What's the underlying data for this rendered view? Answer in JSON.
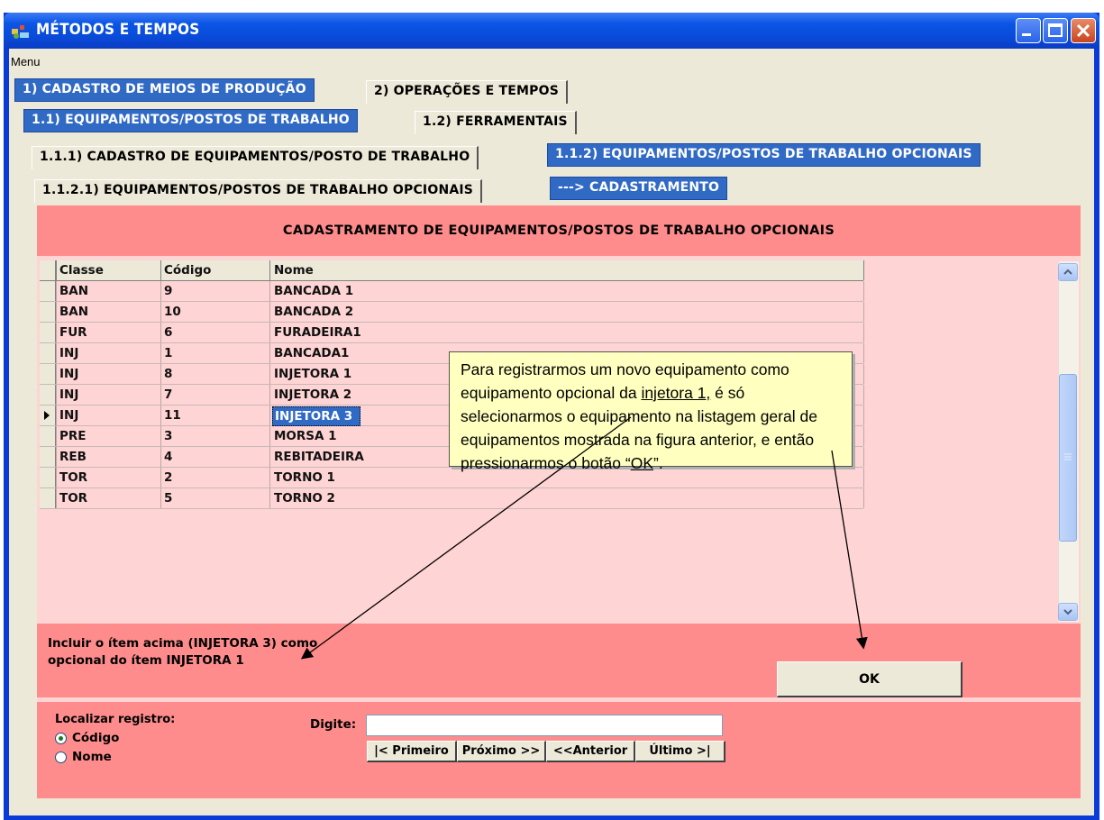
{
  "window": {
    "title": "MÉTODOS E TEMPOS",
    "menu_label": "Menu"
  },
  "tabs_level1": [
    {
      "label": "1) CADASTRO DE MEIOS DE PRODUÇÃO",
      "active": true
    },
    {
      "label": "2) OPERAÇÕES E TEMPOS",
      "active": false
    }
  ],
  "tabs_level2": [
    {
      "label": "1.1) EQUIPAMENTOS/POSTOS DE TRABALHO",
      "active": true
    },
    {
      "label": "1.2) FERRAMENTAIS",
      "active": false
    }
  ],
  "tabs_level3": [
    {
      "label": "1.1.1) CADASTRO DE EQUIPAMENTOS/POSTO DE TRABALHO",
      "active": false
    },
    {
      "label": "1.1.2) EQUIPAMENTOS/POSTOS DE TRABALHO OPCIONAIS",
      "active": true
    }
  ],
  "tabs_level4": [
    {
      "label": "1.1.2.1) EQUIPAMENTOS/POSTOS DE TRABALHO OPCIONAIS",
      "active": false
    },
    {
      "label": "---> CADASTRAMENTO",
      "active": true
    }
  ],
  "panel": {
    "header": "CADASTRAMENTO DE EQUIPAMENTOS/POSTOS DE TRABALHO OPCIONAIS"
  },
  "grid": {
    "columns": [
      "Classe",
      "Código",
      "Nome"
    ],
    "rows": [
      [
        "BAN",
        "9",
        "BANCADA 1"
      ],
      [
        "BAN",
        "10",
        "BANCADA 2"
      ],
      [
        "FUR",
        "6",
        "FURADEIRA1"
      ],
      [
        "INJ",
        "1",
        "BANCADA1"
      ],
      [
        "INJ",
        "8",
        "INJETORA 1"
      ],
      [
        "INJ",
        "7",
        "INJETORA 2"
      ],
      [
        "INJ",
        "11",
        "INJETORA 3"
      ],
      [
        "PRE",
        "3",
        "MORSA 1"
      ],
      [
        "REB",
        "4",
        "REBITADEIRA"
      ],
      [
        "TOR",
        "2",
        "TORNO 1"
      ],
      [
        "TOR",
        "5",
        "TORNO 2"
      ]
    ],
    "selected_row": 6
  },
  "include": {
    "line1": "Incluir o ítem acima (INJETORA 3) como",
    "line2": "opcional do ítem INJETORA 1",
    "ok_label": "OK"
  },
  "locate": {
    "title": "Localizar registro:",
    "option_code": "Código",
    "option_name": "Nome",
    "selected_option": "Código",
    "digite_label": "Digite:",
    "search_value": "",
    "nav_first": "|< Primeiro",
    "nav_next": "Próximo >>",
    "nav_prev": "<<Anterior",
    "nav_last": "Último >|"
  },
  "callout": {
    "part1": "Para registrarmos um novo equipamento como equipamento opcional da ",
    "underlined1": "injetora 1,",
    "part2": " é só selecionarmos o equipamento na listagem geral de equipamentos mostrada na figura anterior, e então pressionarmos o botão “",
    "underlined2": "OK",
    "part3": "”."
  },
  "colors": {
    "active_tab": "#316ac5",
    "panel_band": "#ff8c8c",
    "panel_light": "#ffd4d4",
    "callout_bg": "#ffffc0",
    "titlebar": "#0b55e6"
  }
}
